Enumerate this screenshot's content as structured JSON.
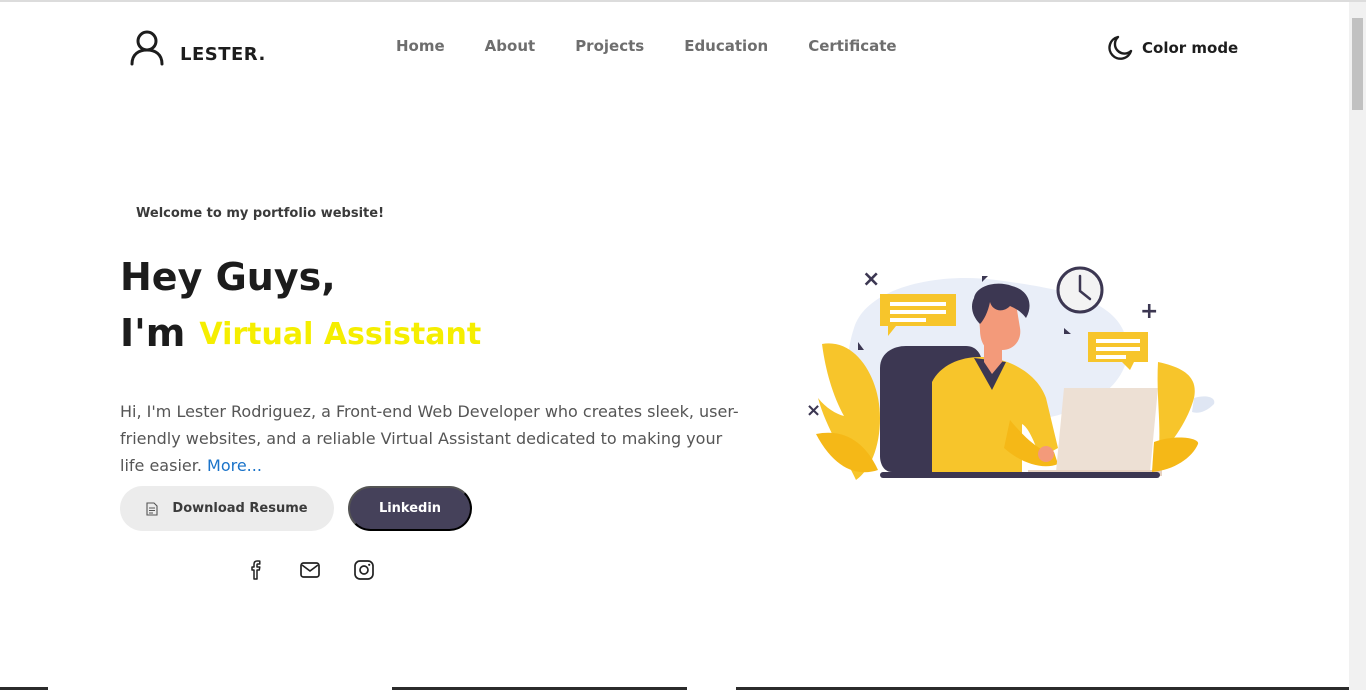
{
  "brand": {
    "name": "LESTER.",
    "icon": "user-icon"
  },
  "nav": {
    "items": [
      {
        "label": "Home"
      },
      {
        "label": "About"
      },
      {
        "label": "Projects"
      },
      {
        "label": "Education"
      },
      {
        "label": "Certificate"
      }
    ]
  },
  "color_mode": {
    "label": "Color mode",
    "icon": "moon-icon"
  },
  "hero": {
    "welcome": "Welcome to my portfolio website!",
    "greeting": "Hey Guys,",
    "im": "I'm",
    "role": "Virtual Assistant",
    "intro": "Hi, I'm Lester Rodriguez, a Front-end Web Developer who creates sleek, user-friendly websites, and a reliable Virtual Assistant dedicated to making your life easier.",
    "more_link": "More...",
    "resume_button": "Download Resume",
    "linkedin_button": "Linkedin"
  },
  "socials": [
    {
      "icon": "facebook-icon"
    },
    {
      "icon": "mail-icon"
    },
    {
      "icon": "instagram-icon"
    }
  ],
  "colors": {
    "accent_yellow": "#f5ee00",
    "button_dark": "#45415a",
    "link_blue": "#1a73c9",
    "illustration_yellow": "#f7c52b"
  }
}
